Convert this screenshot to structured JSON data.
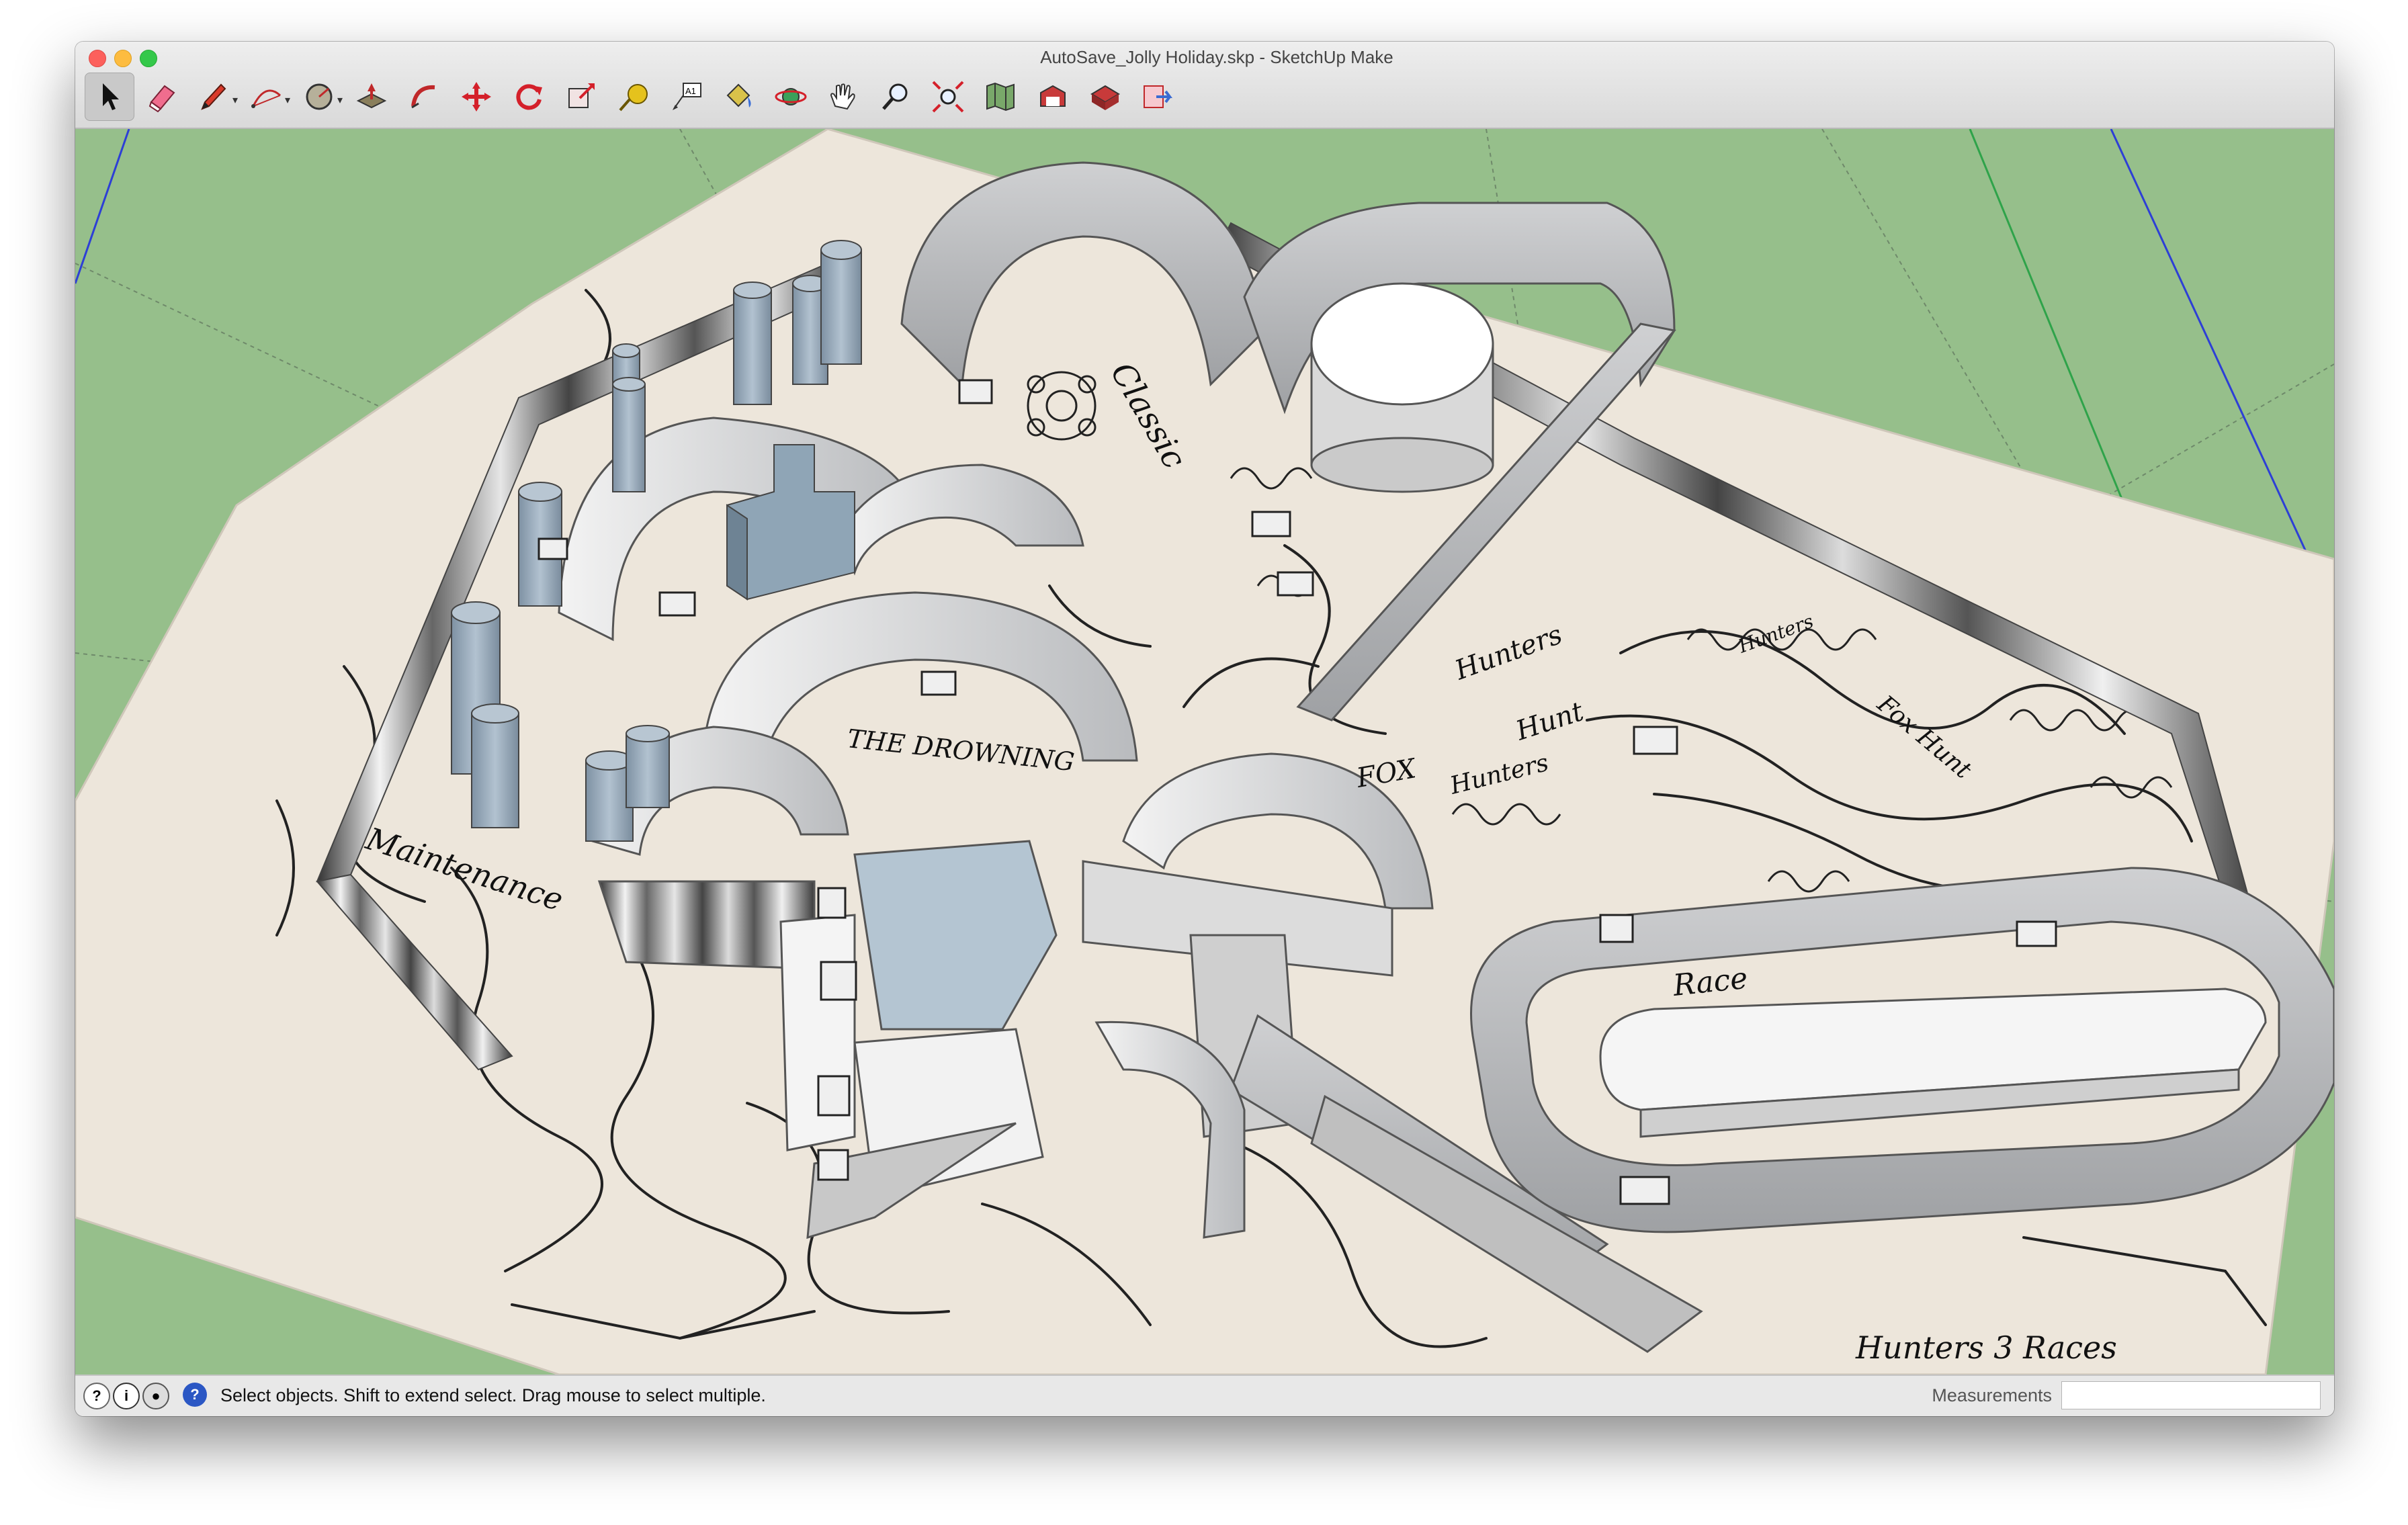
{
  "window": {
    "title": "AutoSave_Jolly Holiday.skp - SketchUp Make"
  },
  "toolbar": {
    "tools": [
      {
        "name": "select-tool",
        "icon": "arrow-cursor-icon"
      },
      {
        "name": "eraser-tool",
        "icon": "eraser-icon"
      },
      {
        "name": "pencil-tool",
        "icon": "pencil-icon"
      },
      {
        "name": "arc-tool",
        "icon": "arc-icon"
      },
      {
        "name": "shape-tool",
        "icon": "circle-shape-icon"
      },
      {
        "name": "push-pull-tool",
        "icon": "push-pull-icon"
      },
      {
        "name": "follow-me-tool",
        "icon": "follow-me-icon"
      },
      {
        "name": "move-tool",
        "icon": "move-arrows-icon"
      },
      {
        "name": "rotate-tool",
        "icon": "rotate-icon"
      },
      {
        "name": "scale-tool",
        "icon": "scale-icon"
      },
      {
        "name": "tape-measure-tool",
        "icon": "tape-measure-icon"
      },
      {
        "name": "text-tool",
        "icon": "text-label-icon"
      },
      {
        "name": "paint-bucket-tool",
        "icon": "paint-bucket-icon"
      },
      {
        "name": "orbit-tool",
        "icon": "orbit-icon"
      },
      {
        "name": "pan-tool",
        "icon": "hand-icon"
      },
      {
        "name": "zoom-tool",
        "icon": "magnifier-icon"
      },
      {
        "name": "zoom-extents-tool",
        "icon": "zoom-extents-icon"
      },
      {
        "name": "map-tool",
        "icon": "map-icon"
      },
      {
        "name": "warehouse-tool",
        "icon": "warehouse-icon"
      },
      {
        "name": "extension-warehouse-tool",
        "icon": "extension-warehouse-icon"
      },
      {
        "name": "send-to-layout-tool",
        "icon": "layout-icon"
      }
    ]
  },
  "model_labels": {
    "classic": "Classic",
    "the_drowning": "THE DROWNING",
    "hunters_1": "Hunters",
    "hunt": "Hunt",
    "fox": "FOX",
    "hunters_2": "Hunters",
    "fox_hunt": "Fox Hunt",
    "maintenance": "Maintenance",
    "race": "Race",
    "hunters_races": "Hunters 3 Races",
    "hunters_3": "Hunters"
  },
  "statusbar": {
    "message": "Select objects. Shift to extend select. Drag mouse to select multiple.",
    "measurements_label": "Measurements",
    "measurements_value": ""
  },
  "colors": {
    "sky_ground": "#96bf8b",
    "paper": "#ede6db",
    "wall_light": "#dcdcdc",
    "wall_dark": "#9a9c9e",
    "water": "#b4c5d2"
  }
}
